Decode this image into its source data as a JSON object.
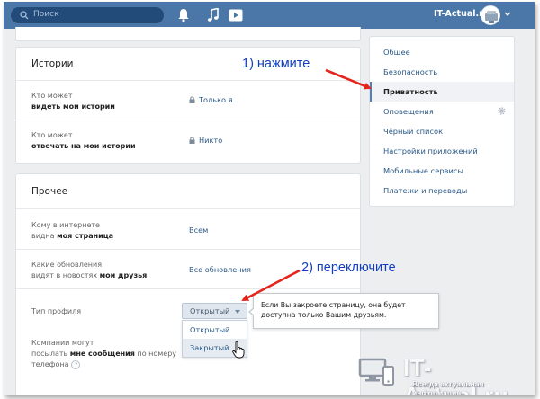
{
  "header": {
    "search_placeholder": "Поиск",
    "site_name": "IT-Actual.ru",
    "icons": [
      "search-icon",
      "bell-icon",
      "music-icon",
      "play-icon",
      "chevron-down-icon"
    ],
    "bar_color": "#4a76a8"
  },
  "stories": {
    "title": "Истории",
    "rows": [
      {
        "label_line1": "Кто может",
        "label_line2": "видеть мои истории",
        "value": "Только я",
        "locked": true
      },
      {
        "label_line1": "Кто может",
        "label_line2": "отвечать на мои истории",
        "value": "Никто",
        "locked": true
      }
    ]
  },
  "other": {
    "title": "Прочее",
    "rows": [
      {
        "label_line1": "Кому в интернете",
        "label_line2_pre": "видна ",
        "label_line2_bold": "моя страница",
        "value": "Всем"
      },
      {
        "label_line1": "Какие обновления",
        "label_line2_pre": "видят в новостях ",
        "label_line2_bold": "мои друзья",
        "value": "Все обновления"
      }
    ],
    "profile_type": {
      "label": "Тип профиля",
      "selected": "Открытый",
      "options": [
        "Открытый",
        "Закрытый"
      ],
      "hovered_option": "Закрытый"
    },
    "companies": {
      "line1": "Компании могут",
      "line2_pre": "посылать ",
      "line2_bold": "мне сообщения",
      "line2_post": " по номеру",
      "line3": "телефона",
      "help_mark": "?"
    }
  },
  "tooltip": {
    "line1": "Если Вы закроете страницу, она будет",
    "line2": "доступна только Вашим друзьям."
  },
  "sidebar": {
    "items": [
      {
        "label": "Общее",
        "active": false
      },
      {
        "label": "Безопасность",
        "active": false
      },
      {
        "label": "Приватность",
        "active": true
      },
      {
        "label": "Оповещения",
        "active": false,
        "icon": "gear-icon"
      },
      {
        "label": "Чёрный список",
        "active": false
      },
      {
        "label": "Настройки приложений",
        "active": false
      },
      {
        "label": "Мобильные сервисы",
        "active": false
      },
      {
        "label": "Платежи и переводы",
        "active": false
      }
    ]
  },
  "annotations": {
    "step1": "1) нажмите",
    "step2": "2) переключите",
    "arrow_color": "#e5241b",
    "text_color": "#0f3fbf"
  },
  "watermark": {
    "title": "IT-Actual.ru",
    "subtitle": "Всегда актуальная информация"
  }
}
